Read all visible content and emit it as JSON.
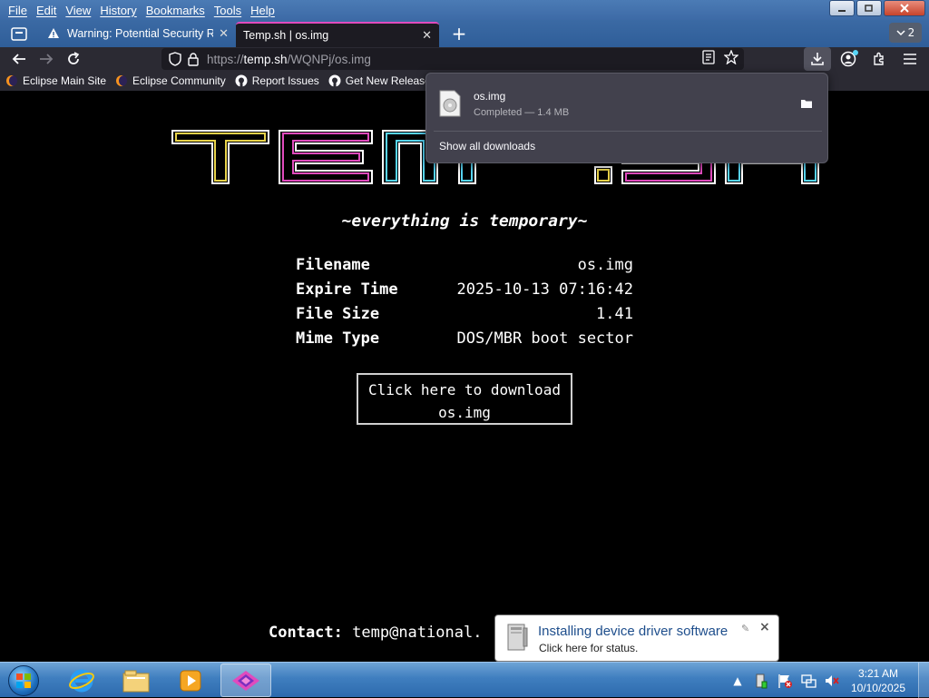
{
  "menubar": {
    "items": [
      "File",
      "Edit",
      "View",
      "History",
      "Bookmarks",
      "Tools",
      "Help"
    ]
  },
  "tabs": [
    {
      "title": "Warning: Potential Security Risk",
      "icon": "warning-icon"
    },
    {
      "title": "Temp.sh | os.img",
      "active": true
    }
  ],
  "tab_count": "2",
  "urlbar": {
    "scheme": "https://",
    "host": "temp.sh",
    "path": "/WQNPj/os.img"
  },
  "bookmarks": [
    {
      "label": "Eclipse Main Site",
      "icon": "eclipse-icon"
    },
    {
      "label": "Eclipse Community",
      "icon": "eclipse-icon"
    },
    {
      "label": "Report Issues",
      "icon": "github-icon"
    },
    {
      "label": "Get New Releases",
      "icon": "github-icon"
    }
  ],
  "downloads_panel": {
    "file_name": "os.img",
    "status": "Completed — 1.4 MB",
    "show_all": "Show all downloads"
  },
  "page": {
    "logo_text": "TEMP.SH",
    "tagline": "~everything is temporary~",
    "info": [
      {
        "key": "Filename",
        "value": "os.img"
      },
      {
        "key": "Expire Time",
        "value": "2025-10-13 07:16:42"
      },
      {
        "key": "File Size",
        "value": "1.41"
      },
      {
        "key": "Mime Type",
        "value": "DOS/MBR boot sector"
      }
    ],
    "download_button": "Click here to download os.img",
    "contact_label": "Contact:",
    "contact_value": "temp@national."
  },
  "balloon": {
    "title": "Installing device driver software",
    "text": "Click here for status."
  },
  "taskbar": {
    "clock_time": "3:21 AM",
    "clock_date": "10/10/2025"
  },
  "colors": {
    "accent_tab": "#e04bbd",
    "chrome_dark": "#2b2a33",
    "taskbar_blue": "#3f7ebf"
  }
}
